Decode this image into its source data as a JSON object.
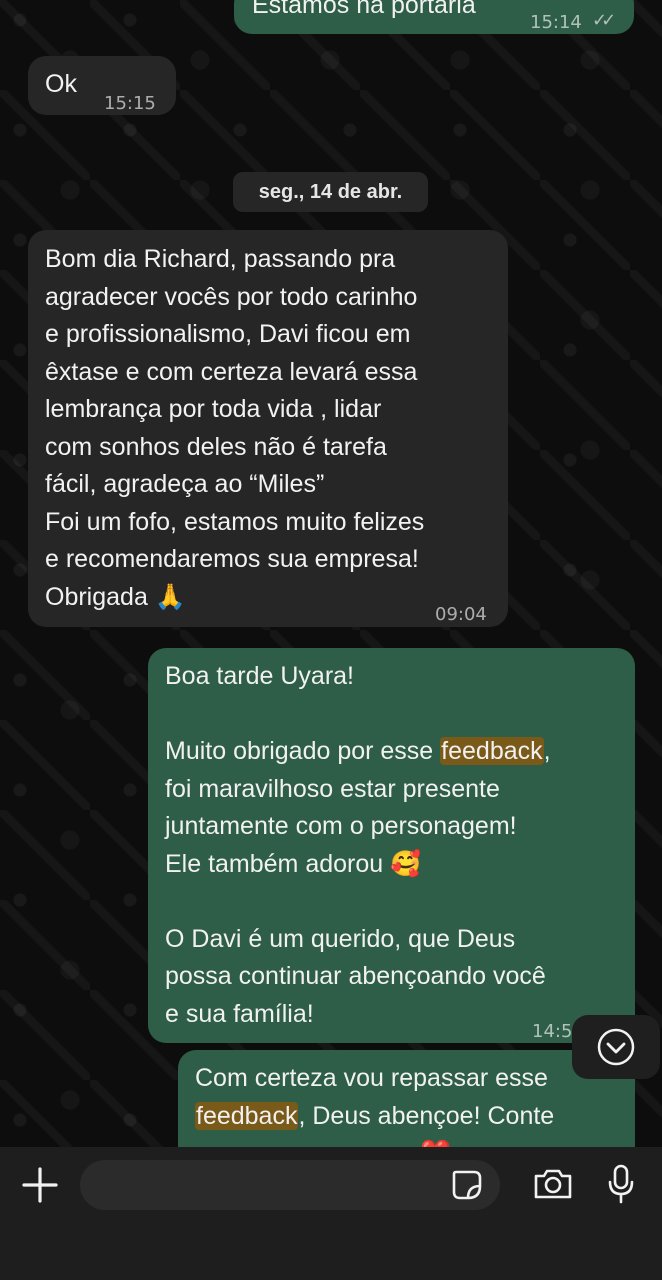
{
  "messages": {
    "msg1": {
      "text": "Estamos na portaria",
      "time": "15:14"
    },
    "msg2": {
      "text": "Ok",
      "time": "15:15"
    },
    "date_separator": "seg., 14 de abr.",
    "msg3": {
      "lines": [
        "Bom dia Richard, passando pra",
        "agradecer vocês por todo carinho",
        "e profissionalismo, Davi ficou em",
        "êxtase e com certeza levará essa",
        "lembrança por toda vida , lidar",
        "com sonhos deles não é tarefa",
        "fácil, agradeça ao “Miles”",
        "Foi um fofo, estamos muito felizes",
        "e recomendaremos sua empresa!",
        "Obrigada 🙏"
      ],
      "time": "09:04"
    },
    "msg4": {
      "line1": "Boa tarde Uyara!",
      "line2_pre": "Muito obrigado por esse ",
      "line2_hl": "feedback",
      "line2_post": ",",
      "line3": "foi maravilhoso estar presente",
      "line4": "juntamente com o personagem!",
      "line5": "Ele também adorou 🥰",
      "line6": "O Davi é um querido, que Deus",
      "line7": "possa continuar abençoando você",
      "line8": "e sua família!",
      "time": "14:5"
    },
    "msg5": {
      "line1": "Com certeza vou repassar esse",
      "line2_hl": "feedback",
      "line2_post": ", Deus abençoe! Conte",
      "emoji": "❤️"
    }
  },
  "composer": {
    "add_icon": "plus-icon",
    "sticker_icon": "sticker-icon",
    "camera_icon": "camera-icon",
    "mic_icon": "microphone-icon"
  },
  "scroll_icon": "chevron-down-icon",
  "colors": {
    "incoming_bubble": "#262626",
    "outgoing_bubble": "#2e5e47",
    "highlight": "#7a5a18",
    "background": "#0b0b0b"
  }
}
